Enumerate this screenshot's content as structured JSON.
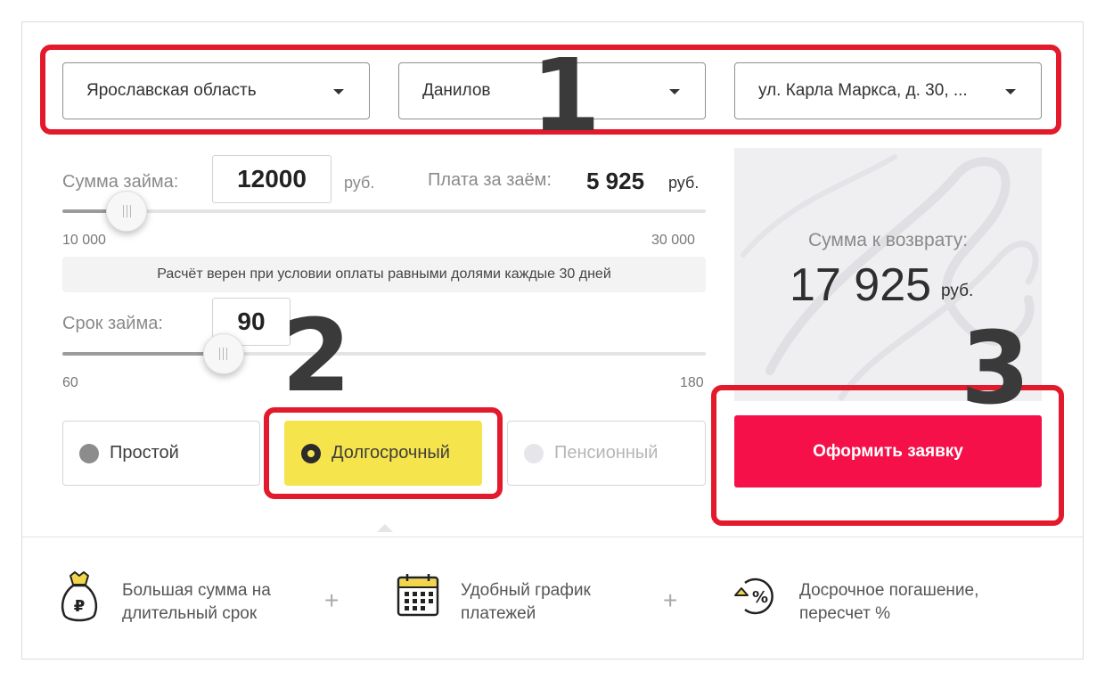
{
  "location": {
    "region": "Ярославская область",
    "city": "Данилов",
    "address": "ул. Карла Маркса, д. 30, ..."
  },
  "markers": {
    "one": "1",
    "two": "2",
    "three": "3"
  },
  "loan": {
    "amount_label": "Сумма займа:",
    "amount_value": "12000",
    "amount_unit": "руб.",
    "fee_label": "Плата за заём:",
    "fee_value": "5 925",
    "fee_unit": "руб.",
    "amount_min": "10 000",
    "amount_max": "30 000",
    "amount_fraction": 0.1,
    "note": "Расчёт верен при условии оплаты равными долями каждые 30 дней",
    "term_label": "Срок займа:",
    "term_value": "90",
    "term_min": "60",
    "term_max": "180",
    "term_fraction": 0.25
  },
  "summary": {
    "title": "Сумма к возврату:",
    "value": "17 925",
    "unit": "руб."
  },
  "options": [
    {
      "label": "Простой",
      "state": "normal"
    },
    {
      "label": "Долгосрочный",
      "state": "selected"
    },
    {
      "label": "Пенсионный",
      "state": "disabled"
    }
  ],
  "cta_label": "Оформить заявку",
  "features": [
    {
      "icon": "money-bag-icon",
      "line1": "Большая сумма на",
      "line2": "длительный срок"
    },
    {
      "icon": "calendar-icon",
      "line1": "Удобный график",
      "line2": "платежей"
    },
    {
      "icon": "percent-icon",
      "line1": "Досрочное погашение,",
      "line2": "пересчет %"
    }
  ],
  "plus_sign": "+",
  "colors": {
    "highlight": "#e3192c",
    "cta": "#f5104a",
    "selected_option": "#f6e44c"
  }
}
